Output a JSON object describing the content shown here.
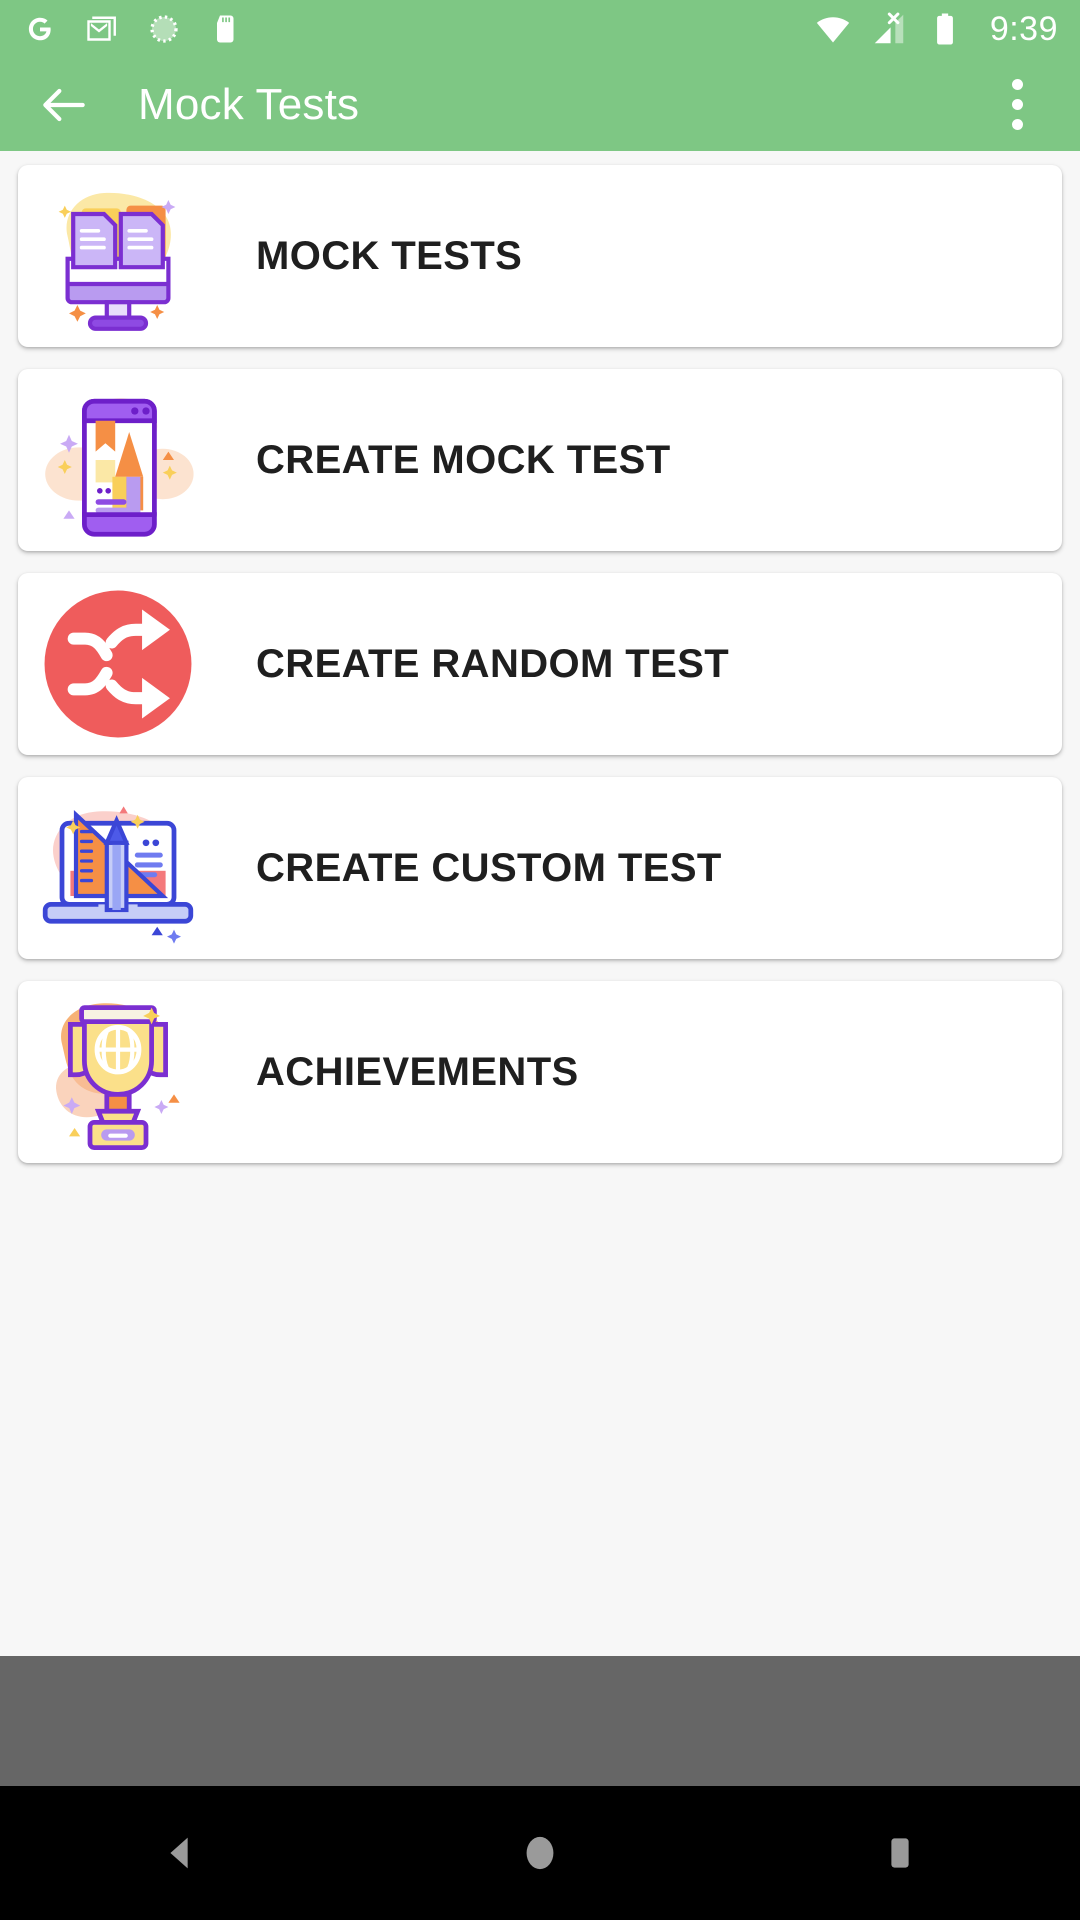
{
  "status_bar": {
    "left_icons": [
      {
        "name": "google-icon",
        "label": "G"
      },
      {
        "name": "gmail-icon",
        "label": "Gmail"
      },
      {
        "name": "sync-spinner-icon",
        "label": "Sync"
      },
      {
        "name": "sd-card-icon",
        "label": "SD Card"
      }
    ],
    "right_icons": [
      {
        "name": "wifi-icon",
        "label": "Wi-Fi"
      },
      {
        "name": "cellular-no-signal-icon",
        "label": "No SIM"
      },
      {
        "name": "battery-icon",
        "label": "Battery"
      }
    ],
    "time": "9:39",
    "background_color": "#7ec784"
  },
  "app_bar": {
    "back_icon": "arrow-left-icon",
    "title": "Mock Tests",
    "overflow_icon": "more-vertical-icon",
    "background_color": "#7ec784",
    "text_color": "#ffffff"
  },
  "main": {
    "cards": [
      {
        "label": "MOCK TESTS",
        "icon": "monitor-documents-icon",
        "accent": "#f7d44c"
      },
      {
        "label": "CREATE MOCK TEST",
        "icon": "phone-pencil-icon",
        "accent": "#fbd9c0"
      },
      {
        "label": "CREATE RANDOM TEST",
        "icon": "shuffle-icon",
        "accent": "#ef5c5c"
      },
      {
        "label": "CREATE CUSTOM TEST",
        "icon": "laptop-ruler-pencil-icon",
        "accent": "#fbc9c2"
      },
      {
        "label": "ACHIEVEMENTS",
        "icon": "trophy-icon",
        "accent": "#f9a662"
      }
    ],
    "background_color": "#f7f7f7",
    "card_background": "#ffffff",
    "label_color": "#1f1f1f"
  },
  "nav_bar": {
    "buttons": [
      {
        "name": "nav-back-button",
        "icon": "triangle-back-icon"
      },
      {
        "name": "nav-home-button",
        "icon": "circle-home-icon"
      },
      {
        "name": "nav-recents-button",
        "icon": "square-recents-icon"
      }
    ],
    "background_color": "#000000",
    "icon_color": "#9a9a9a"
  },
  "gray_band": {
    "color": "#666666"
  }
}
